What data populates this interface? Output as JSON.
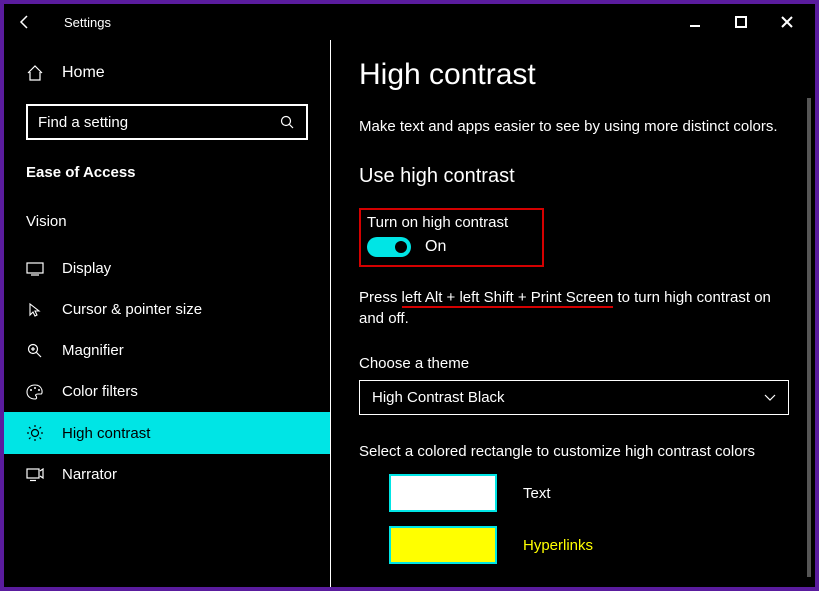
{
  "window": {
    "title": "Settings"
  },
  "sidebar": {
    "home": "Home",
    "search_placeholder": "Find a setting",
    "category": "Ease of Access",
    "group": "Vision",
    "items": [
      {
        "label": "Display"
      },
      {
        "label": "Cursor & pointer size"
      },
      {
        "label": "Magnifier"
      },
      {
        "label": "Color filters"
      },
      {
        "label": "High contrast"
      },
      {
        "label": "Narrator"
      }
    ]
  },
  "main": {
    "heading": "High contrast",
    "description": "Make text and apps easier to see by using more distinct colors.",
    "section1": "Use high contrast",
    "toggle_label": "Turn on high contrast",
    "toggle_state": "On",
    "shortcut_pre": "Press ",
    "shortcut_keys": "left Alt + left Shift + Print Screen",
    "shortcut_post": " to turn high contrast on and off.",
    "theme_label": "Choose a theme",
    "theme_value": "High Contrast Black",
    "swatch_label": "Select a colored rectangle to customize high contrast colors",
    "swatches": {
      "text": "Text",
      "hyperlinks": "Hyperlinks"
    }
  }
}
